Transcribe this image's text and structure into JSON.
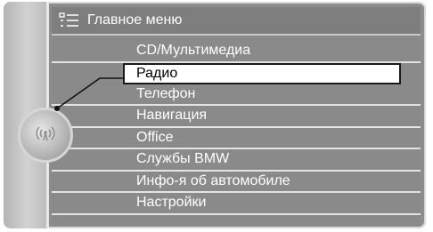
{
  "header": {
    "title": "Главное меню",
    "icon": "menu-list-icon"
  },
  "menu": {
    "items": [
      {
        "label": "CD/Мультимедиа"
      },
      {
        "label": "Радио",
        "selected": true
      },
      {
        "label": "Телефон"
      },
      {
        "label": "Навигация"
      },
      {
        "label": "Office"
      },
      {
        "label": "Службы BMW"
      },
      {
        "label": "Инфо-я об автомобиле"
      },
      {
        "label": "Настройки"
      }
    ]
  },
  "controller": {
    "icon": "radio-antenna-icon"
  },
  "colors": {
    "background": "#8a8a8a",
    "separator": "#e4e4e4",
    "selection_bg": "#ffffff",
    "selection_border": "#1a1a1a",
    "text": "#ffffff"
  }
}
